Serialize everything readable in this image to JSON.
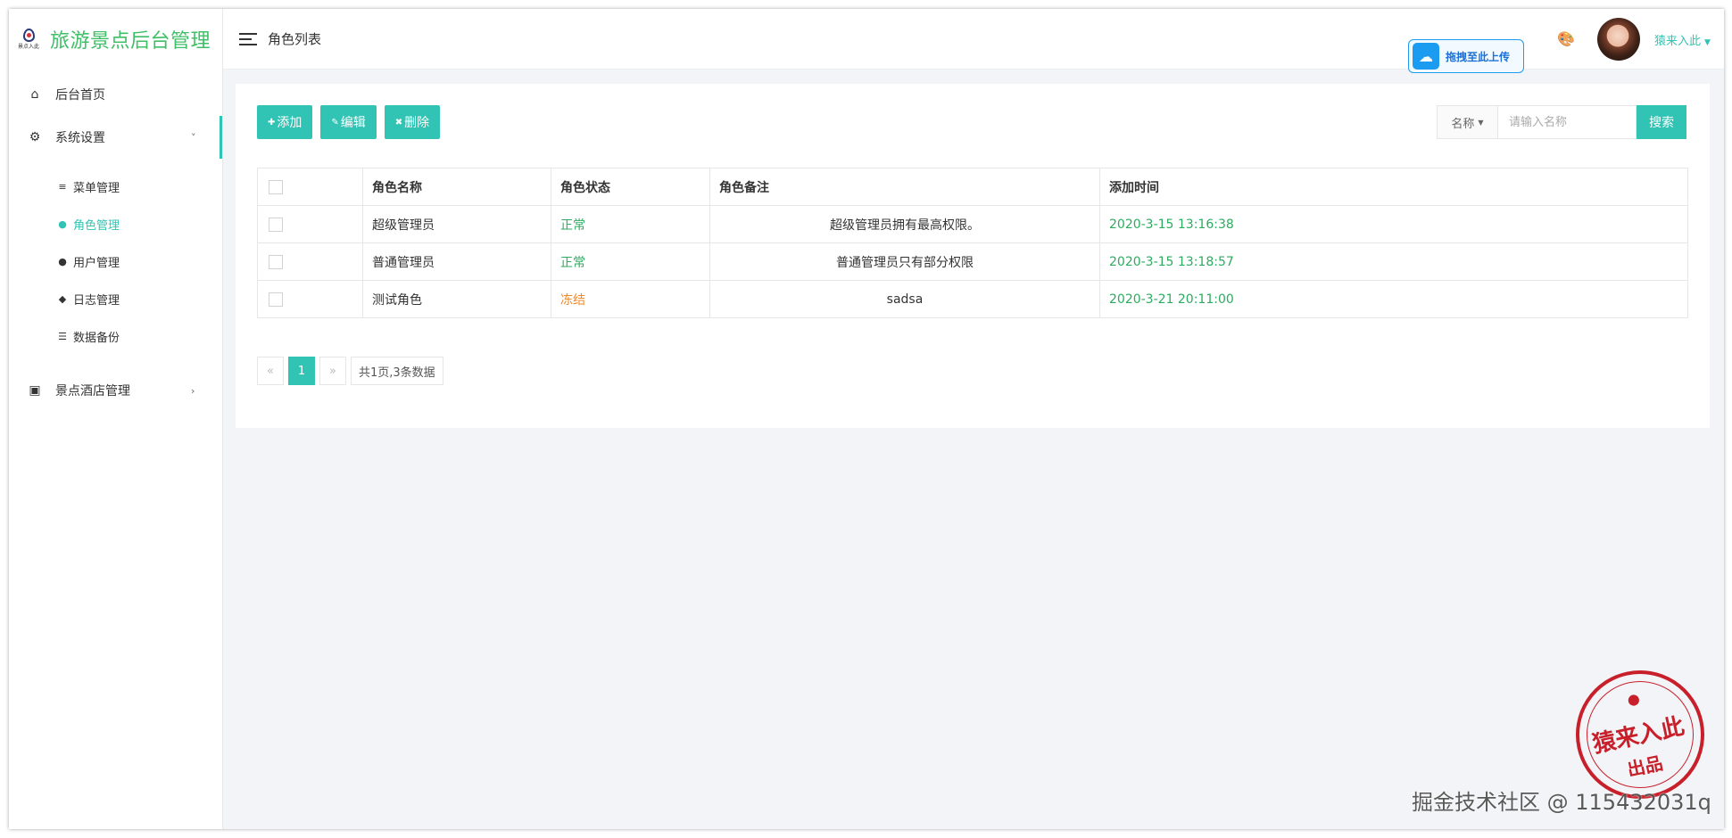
{
  "app": {
    "logo_caption": "景点入此",
    "title": "旅游景点后台管理"
  },
  "sidebar": {
    "items": [
      {
        "label": "后台首页",
        "icon": "home-icon"
      },
      {
        "label": "系统设置",
        "icon": "gear-icon"
      },
      {
        "label": "景点酒店管理",
        "icon": "image-icon"
      }
    ],
    "sub_items": [
      {
        "label": "菜单管理",
        "icon": "list-icon"
      },
      {
        "label": "角色管理",
        "icon": "user-role-icon"
      },
      {
        "label": "用户管理",
        "icon": "users-icon"
      },
      {
        "label": "日志管理",
        "icon": "tag-icon"
      },
      {
        "label": "数据备份",
        "icon": "database-icon"
      }
    ]
  },
  "header": {
    "page_title": "角色列表",
    "upload_label": "拖拽至此上传",
    "username": "猿来入此"
  },
  "toolbar": {
    "add_label": "添加",
    "edit_label": "编辑",
    "delete_label": "删除"
  },
  "search": {
    "field_label": "名称",
    "placeholder": "请输入名称",
    "button_label": "搜索"
  },
  "table": {
    "headers": [
      "角色名称",
      "角色状态",
      "角色备注",
      "添加时间"
    ],
    "rows": [
      {
        "name": "超级管理员",
        "status": "正常",
        "remark": "超级管理员拥有最高权限。",
        "time": "2020-3-15 13:16:38"
      },
      {
        "name": "普通管理员",
        "status": "正常",
        "remark": "普通管理员只有部分权限",
        "time": "2020-3-15 13:18:57"
      },
      {
        "name": "测试角色",
        "status": "冻结",
        "remark": "sadsa",
        "time": "2020-3-21 20:11:00"
      }
    ]
  },
  "pagination": {
    "prev": "«",
    "current": "1",
    "next": "»",
    "info": "共1页,3条数据"
  },
  "stamp": {
    "main": "猿来入此",
    "sub": "出品"
  },
  "watermark": "掘金技术社区 @ 115432031q",
  "colors": {
    "accent": "#31c3b3",
    "logo_green": "#3fbf66",
    "status_normal": "#2dab60",
    "status_frozen": "#f0892a",
    "stamp_red": "#c8202b"
  }
}
